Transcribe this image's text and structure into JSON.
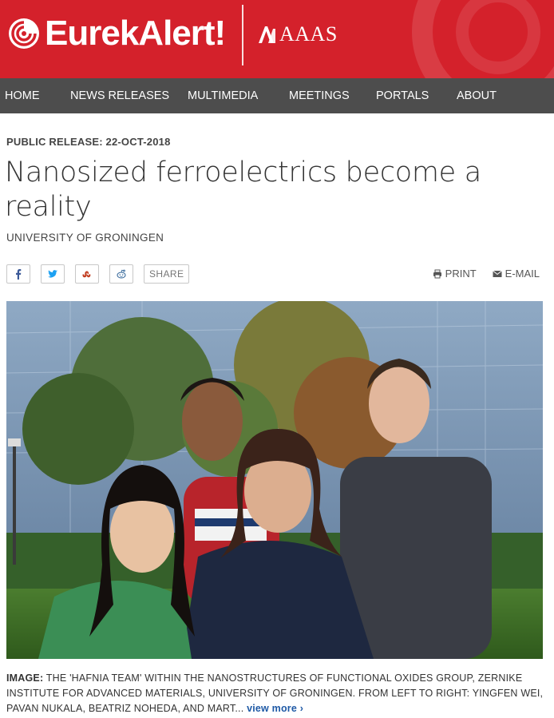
{
  "header": {
    "brand": "EurekAlert!",
    "partner": "AAAS",
    "colors": {
      "brand_red": "#d4212b",
      "nav_bg": "#4d4d4d",
      "link_blue": "#1f5aa6"
    }
  },
  "nav": {
    "items": [
      "HOME",
      "NEWS RELEASES",
      "MULTIMEDIA",
      "MEETINGS",
      "PORTALS",
      "ABOUT"
    ]
  },
  "article": {
    "release_label": "PUBLIC RELEASE:",
    "release_date": "22-OCT-2018",
    "title": "Nanosized ferroelectrics become a reality",
    "organization": "UNIVERSITY OF GRONINGEN"
  },
  "share": {
    "icons": [
      "facebook-icon",
      "twitter-icon",
      "stumbleupon-icon",
      "reddit-icon"
    ],
    "share_label": "SHARE",
    "print_label": "PRINT",
    "email_label": "E-MAIL"
  },
  "image": {
    "caption_label": "IMAGE:",
    "caption_text": "THE 'HAFNIA TEAM' WITHIN THE NANOSTRUCTURES OF FUNCTIONAL OXIDES GROUP, ZERNIKE INSTITUTE FOR ADVANCED MATERIALS, UNIVERSITY OF GRONINGEN. FROM LEFT TO RIGHT: YINGFEN WEI, PAVAN NUKALA, BEATRIZ NOHEDA, AND MART...",
    "view_more": "view more"
  }
}
